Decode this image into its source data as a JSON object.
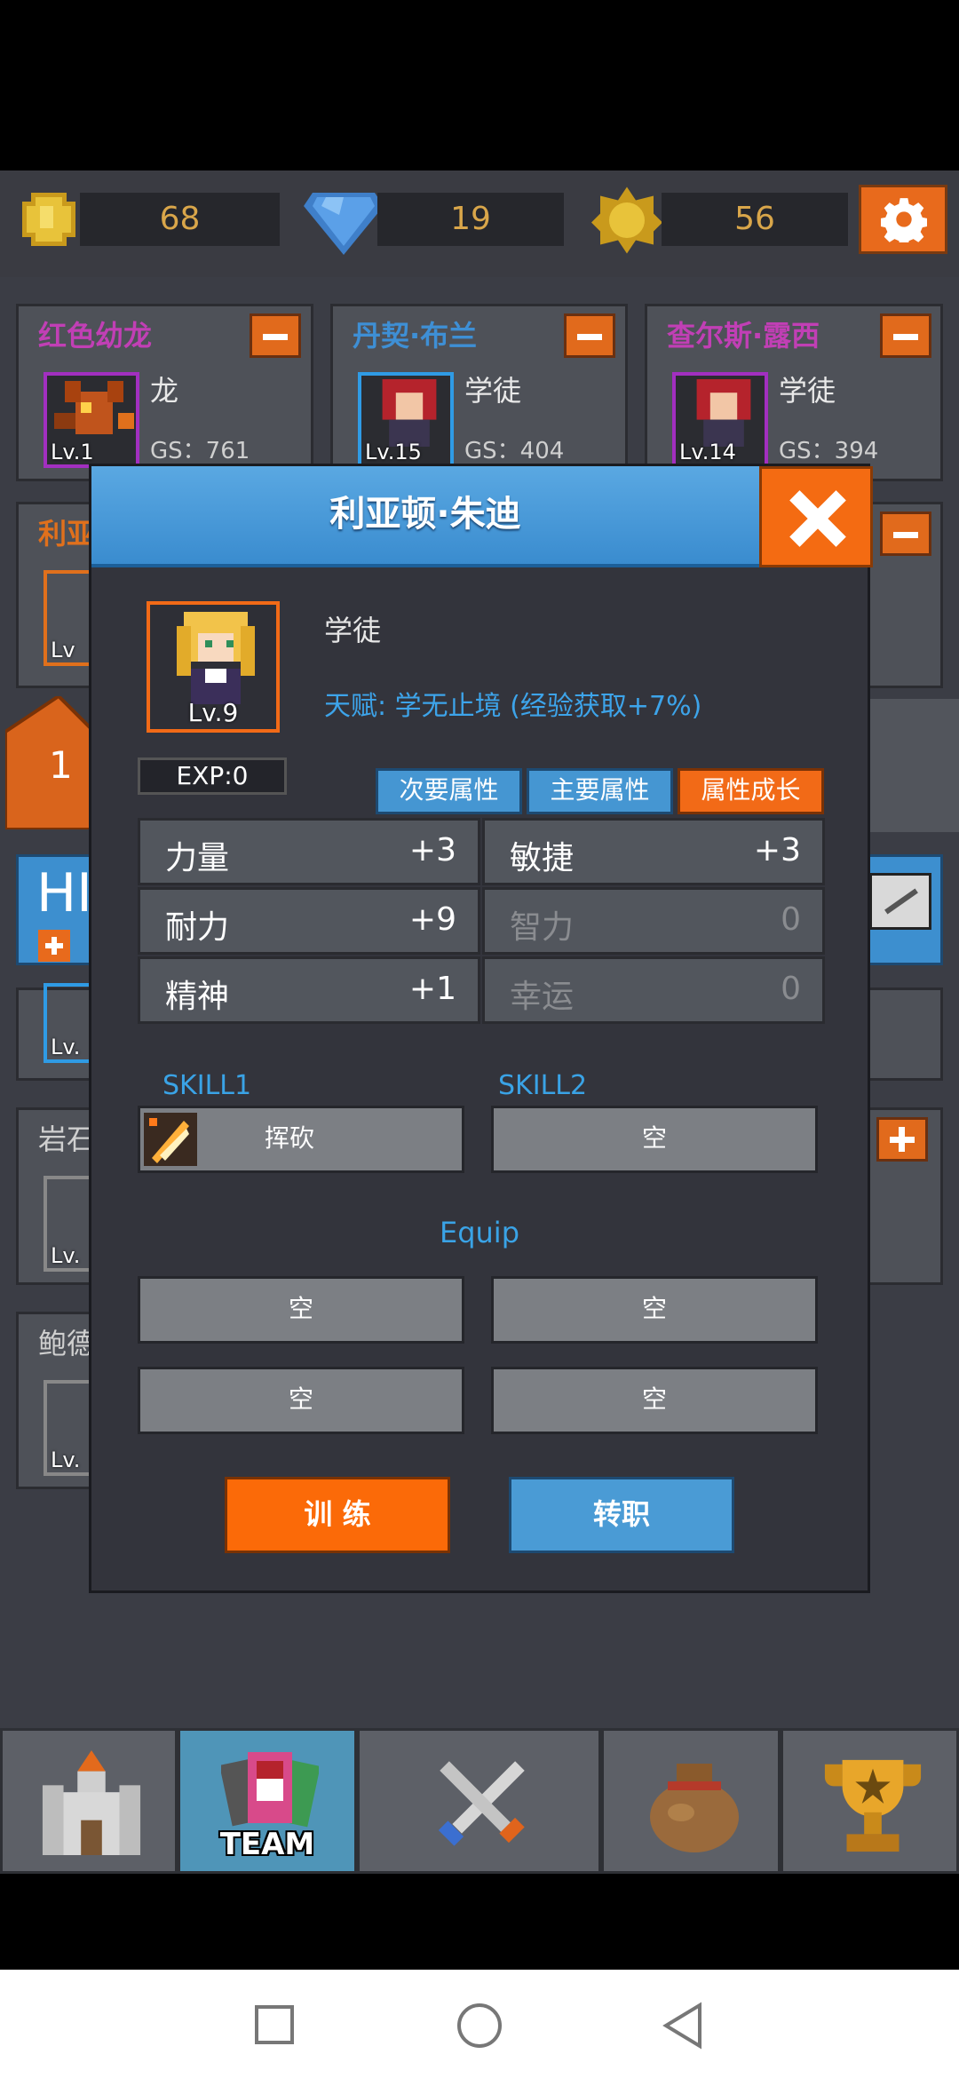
{
  "resources": {
    "gold": "68",
    "gems": "19",
    "medals": "56"
  },
  "team_cards": [
    {
      "name": "红色幼龙",
      "class": "龙",
      "level": "Lv.1",
      "gs": "GS：761"
    },
    {
      "name": "丹契·布兰",
      "class": "学徒",
      "level": "Lv.15",
      "gs": "GS：404"
    },
    {
      "name": "查尔斯·露西",
      "class": "学徒",
      "level": "Lv.14",
      "gs": "GS：394"
    }
  ],
  "background_partial": {
    "card4_name": "利亚",
    "card4_level": "Lv",
    "num_badge": "1",
    "hi_text": "HI",
    "rock_name": "岩石",
    "rock_level": "Lv.",
    "bao_name": "鲍德",
    "bao_level": "Lv.",
    "lv_small": "Lv."
  },
  "modal": {
    "title": "利亚顿·朱迪",
    "hero_level": "Lv.9",
    "hero_class": "学徒",
    "talent": "天赋: 学无止境 (经验获取+7%)",
    "exp": "EXP:0",
    "tabs": [
      "次要属性",
      "主要属性",
      "属性成长"
    ],
    "active_tab": 2,
    "attributes": [
      {
        "name": "力量",
        "value": "+3"
      },
      {
        "name": "敏捷",
        "value": "+3"
      },
      {
        "name": "耐力",
        "value": "+9"
      },
      {
        "name": "智力",
        "value": "0"
      },
      {
        "name": "精神",
        "value": "+1"
      },
      {
        "name": "幸运",
        "value": "0"
      }
    ],
    "skill1_label": "SKILL1",
    "skill2_label": "SKILL2",
    "skill1": "挥砍",
    "skill2": "空",
    "equip_label": "Equip",
    "equip_slots": [
      "空",
      "空",
      "空",
      "空"
    ],
    "train_button": "训 练",
    "job_button": "转职"
  },
  "bottom_nav": {
    "items": [
      "castle-icon",
      "team-icon",
      "battle-icon",
      "loot-bag-icon",
      "trophy-icon"
    ],
    "team_label": "TEAM",
    "active_index": 1
  },
  "colors": {
    "accent_orange": "#f26a17",
    "accent_blue": "#4596d2",
    "talent_blue": "#3da4ea",
    "gold_text": "#d9a64a"
  }
}
